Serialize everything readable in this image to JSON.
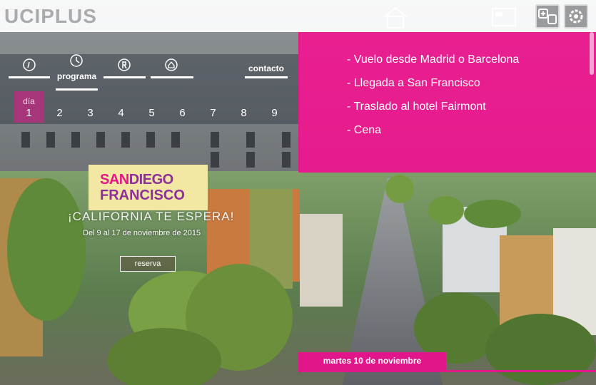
{
  "header": {
    "logo": "UCIPLUS",
    "home_icon": "home-icon",
    "flag_icon": "flag-icon",
    "lang_icon": "language-switch-icon",
    "settings_icon": "settings-icon"
  },
  "nav": {
    "items": [
      {
        "label": "",
        "icon": "info-icon"
      },
      {
        "label": "programa",
        "icon": "clock-icon"
      },
      {
        "label": "",
        "icon": "hotel-icon"
      },
      {
        "label": "",
        "icon": "location-icon"
      },
      {
        "label": "contacto",
        "icon": ""
      }
    ],
    "active_index": 1
  },
  "days": {
    "label": "día",
    "items": [
      "1",
      "2",
      "3",
      "4",
      "5",
      "6",
      "7",
      "8",
      "9"
    ],
    "active_index": 0
  },
  "itinerary": {
    "items": [
      "- Vuelo desde Madrid o Barcelona",
      "- Llegada a San Francisco",
      "- Traslado al hotel Fairmont",
      "- Cena"
    ]
  },
  "promo": {
    "logo_part1": "SAN",
    "logo_part2": "DIEGO",
    "logo_part3": "FRANCISCO",
    "tagline": "¡CALIFORNIA TE ESPERA!",
    "dates": "Del 9 al 17 de noviembre de 2015",
    "button": "reserva"
  },
  "date_banner": "martes 10 de noviembre",
  "colors": {
    "accent": "#EC128C",
    "active_day": "#A6357A"
  }
}
